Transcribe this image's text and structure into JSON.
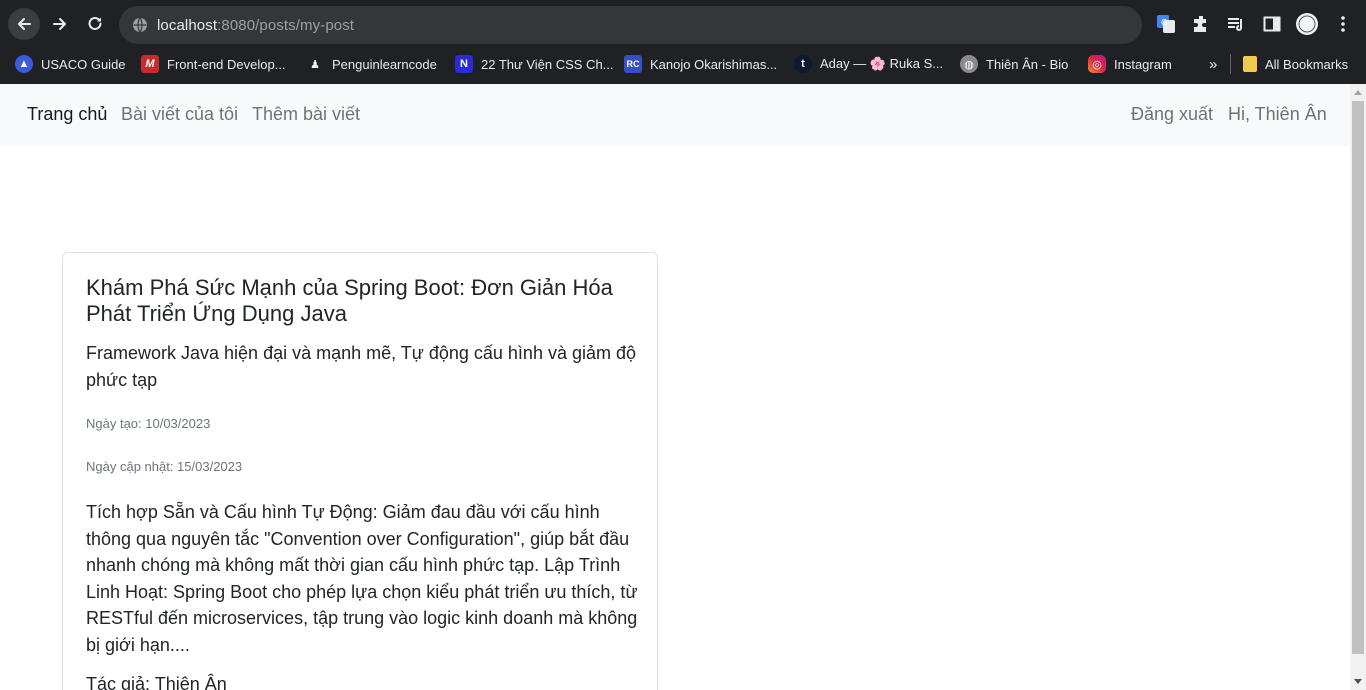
{
  "browser": {
    "url_host": "localhost",
    "url_rest": ":8080/posts/my-post",
    "bookmarks": [
      {
        "label": "USACO Guide",
        "color": "#3b5bdb"
      },
      {
        "label": "Front-end Develop...",
        "color": "#c92a2a"
      },
      {
        "label": "Penguinlearncode",
        "color": "#f2f2f2"
      },
      {
        "label": "22 Thư Viện CSS Ch...",
        "color": "#2b2bd8"
      },
      {
        "label": "Kanojo Okarishimas...",
        "color": "#364fc7"
      },
      {
        "label": "Aday — 🌸 Ruka S...",
        "color": "#0b1a2e"
      },
      {
        "label": "Thiên Ân - Bio",
        "color": "#8a8a8a"
      },
      {
        "label": "Instagram",
        "color": "#d6249f"
      }
    ],
    "bookmarks_overflow": "»",
    "all_bookmarks": "All Bookmarks"
  },
  "nav": {
    "home": "Trang chủ",
    "my_posts": "Bài viết của tôi",
    "add_post": "Thêm bài viết",
    "logout": "Đăng xuất",
    "greeting": "Hi, Thiên Ân"
  },
  "post": {
    "title": "Khám Phá Sức Mạnh của Spring Boot: Đơn Giản Hóa Phát Triển Ứng Dụng Java",
    "subtitle": "Framework Java hiện đại và mạnh mẽ, Tự động cấu hình và giảm độ phức tạp",
    "created": "Ngày tạo: 10/03/2023",
    "updated": "Ngày cập nhật: 15/03/2023",
    "excerpt": "Tích hợp Sẵn và Cấu hình Tự Động: Giảm đau đầu với cấu hình thông qua nguyên tắc \"Convention over Configuration\", giúp bắt đầu nhanh chóng mà không mất thời gian cấu hình phức tạp. Lập Trình Linh Hoạt: Spring Boot cho phép lựa chọn kiểu phát triển ưu thích, từ RESTful đến microservices, tập trung vào logic kinh doanh mà không bị giới hạn....",
    "author": "Tác giả: Thiên Ân"
  }
}
